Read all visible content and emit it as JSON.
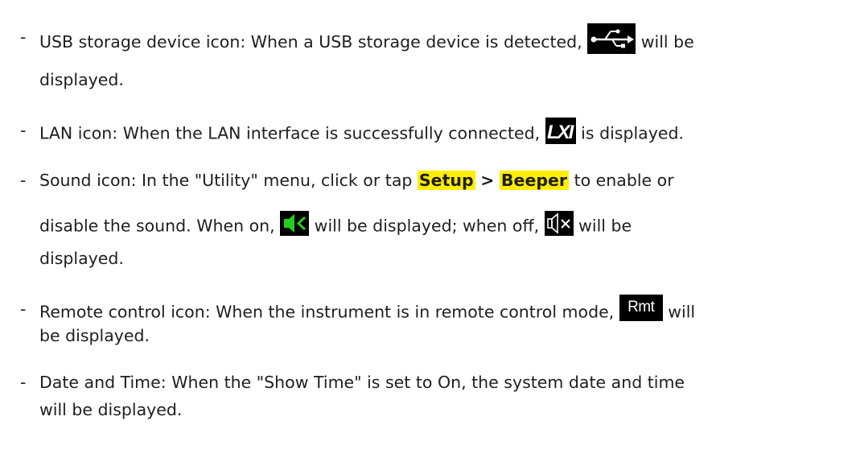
{
  "items": [
    {
      "dash": "-",
      "line1_before": "USB storage device icon: When a USB storage device is detected, ",
      "line1_after": " will be",
      "line2": "displayed.",
      "icon": "usb-icon"
    },
    {
      "dash": "-",
      "line1_before": "LAN icon: When the LAN interface is successfully connected, ",
      "line1_after": " is displayed.",
      "icon": "lxi-icon"
    },
    {
      "dash": "-",
      "line1_before": "Sound icon: In the \"Utility\" menu, click or tap ",
      "setup": "Setup",
      "gt": ">",
      "beeper": "Beeper",
      "line1_after": " to enable or",
      "line2_before": "disable the sound. When on, ",
      "line2_mid": " will be displayed; when off, ",
      "line2_after": " will be",
      "line3": "displayed.",
      "icon_on": "sound-on-icon",
      "icon_off": "sound-off-icon"
    },
    {
      "dash": "-",
      "line1_before": "Remote control icon: When the instrument is in remote control mode, ",
      "rmt_text": "Rmt",
      "line1_after": " will",
      "line2": "be displayed.",
      "icon": "remote-icon"
    },
    {
      "dash": "-",
      "line1": "Date and Time: When the \"Show Time\" is set to On, the system date and time",
      "line2": "will be displayed."
    }
  ],
  "colors": {
    "highlight": "#ffee00",
    "text": "#1e1e1e",
    "icon_bg": "#000000",
    "sound_on": "#22cc22"
  }
}
